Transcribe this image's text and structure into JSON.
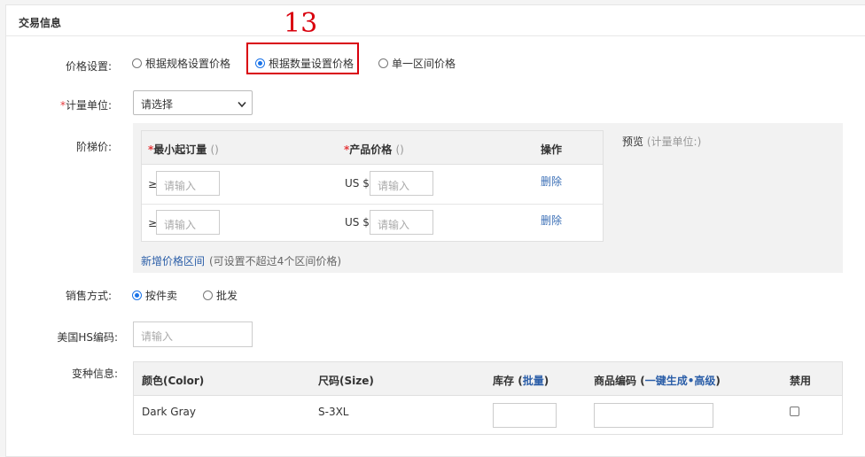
{
  "section": {
    "title": "交易信息"
  },
  "annotation": {
    "number": "13"
  },
  "price_setting": {
    "label": "价格设置:",
    "options": [
      {
        "label": "根据规格设置价格",
        "selected": false
      },
      {
        "label": "根据数量设置价格",
        "selected": true
      },
      {
        "label": "单一区间价格",
        "selected": false
      }
    ]
  },
  "unit": {
    "required_mark": "*",
    "label": "计量单位:",
    "selected": "请选择",
    "arrow": "chevron-down-icon"
  },
  "tier": {
    "label": "阶梯价:",
    "headers": {
      "min_qty": {
        "required_mark": "*",
        "text": "最小起订量",
        "hint": "()"
      },
      "price": {
        "required_mark": "*",
        "text": "产品价格",
        "hint": "()"
      },
      "action": "操作"
    },
    "rows": [
      {
        "ge": "≥",
        "qty_placeholder": "请输入",
        "currency": "US $",
        "price_placeholder": "请输入",
        "delete": "删除"
      },
      {
        "ge": "≥",
        "qty_placeholder": "请输入",
        "currency": "US $",
        "price_placeholder": "请输入",
        "delete": "删除"
      }
    ],
    "preview": {
      "text": "预览",
      "hint": "(计量单位:)"
    },
    "add_link": "新增价格区间",
    "add_hint": "(可设置不超过4个区间价格)"
  },
  "sale_method": {
    "label": "销售方式:",
    "options": [
      {
        "label": "按件卖",
        "selected": true
      },
      {
        "label": "批发",
        "selected": false
      }
    ]
  },
  "hs_code": {
    "label": "美国HS编码:",
    "placeholder": "请输入"
  },
  "variants": {
    "label": "变种信息:",
    "headers": {
      "color": "颜色(Color)",
      "size": "尺码(Size)",
      "stock": "库存",
      "stock_link": "批量",
      "sku": "商品编码",
      "sku_link1": "一键生成",
      "sku_dot": "•",
      "sku_link2": "高级",
      "disable": "禁用"
    },
    "rows": [
      {
        "color": "Dark Gray",
        "size": "S-3XL",
        "stock": "",
        "sku": "",
        "disabled": false
      }
    ]
  },
  "colors": {
    "accent": "#1a73e8",
    "link": "#2b5ea8",
    "required": "#e4393c",
    "annotation": "#d9000d"
  }
}
